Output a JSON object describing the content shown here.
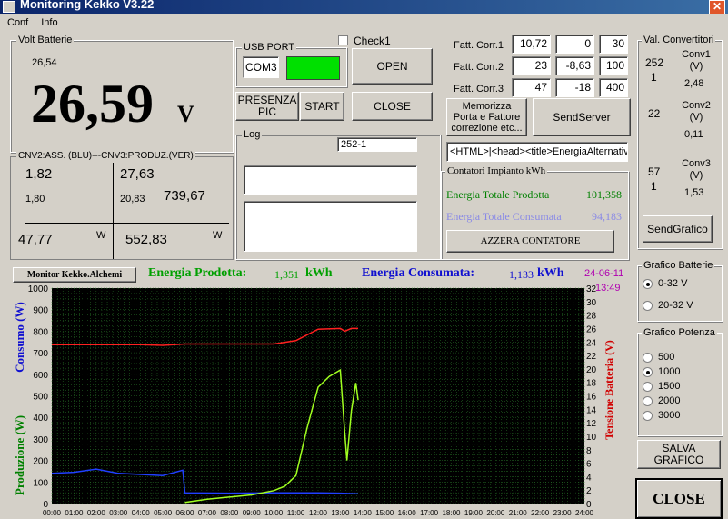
{
  "window": {
    "title": "Monitoring Kekko V3.22"
  },
  "menu": {
    "conf": "Conf",
    "info": "Info"
  },
  "volt": {
    "group": "Volt Batterie",
    "small": "26,54",
    "big": "26,59",
    "unit": "V"
  },
  "cnv": {
    "group": "CNV2:ASS. (BLU)---CNV3:PRODUZ.(VER)",
    "a1": "1,82",
    "a2": "1,80",
    "b1": "27,63",
    "b2": "20,83",
    "b3": "739,67",
    "w1": "47,77",
    "w1u": "W",
    "w2": "552,83",
    "w2u": "W"
  },
  "usb": {
    "group": "USB PORT",
    "port": "COM3",
    "status_color": "#00e000",
    "check1": "Check1",
    "open": "OPEN",
    "presenza": "PRESENZA PIC",
    "start": "START",
    "close": "CLOSE"
  },
  "log": {
    "group": "Log",
    "field1": "252-1",
    "field2": "",
    "field3": ""
  },
  "fatt": {
    "rows": [
      {
        "label": "Fatt. Corr.1",
        "v1": "10,72",
        "v2": "0",
        "v3": "30"
      },
      {
        "label": "Fatt. Corr.2",
        "v1": "23",
        "v2": "-8,63",
        "v3": "100"
      },
      {
        "label": "Fatt. Corr.3",
        "v1": "47",
        "v2": "-18",
        "v3": "400"
      }
    ],
    "memorizza": "Memorizza Porta e Fattore correzione etc...",
    "sendserver": "SendServer",
    "html": "<HTML>|<head><title>EnergiaAlternativa"
  },
  "contatori": {
    "group": "Contatori Impianto kWh",
    "prod_label": "Energia Totale Prodotta",
    "prod_value": "101,358",
    "cons_label": "Energia Totale Consumata",
    "cons_value": "94,183",
    "azzera": "AZZERA CONTATORE",
    "prod_color": "#008000",
    "cons_color": "#8a8ae6"
  },
  "conv": {
    "group": "Val. Convertitori",
    "c1": {
      "a": "252",
      "b": "1",
      "name": "Conv1 (V)",
      "val": "2,48"
    },
    "c2": {
      "a": "22",
      "b": "",
      "name": "Conv2 (V)",
      "val": "0,11"
    },
    "c3": {
      "a": "57",
      "b": "1",
      "name": "Conv3 (V)",
      "val": "1,53"
    },
    "sendgrafico": "SendGrafico"
  },
  "grafbat": {
    "group": "Grafico Batterie",
    "opts": [
      "0-32 V",
      "20-32 V"
    ],
    "selected": 0
  },
  "grafpot": {
    "group": "Grafico Potenza",
    "opts": [
      "500",
      "1000",
      "1500",
      "2000",
      "3000"
    ],
    "selected": 1
  },
  "salva": "SALVA GRAFICO",
  "closebig": "CLOSE",
  "monitor": {
    "brand": "Monitor Kekko.Alchemi",
    "prod_label": "Energia Prodotta:",
    "prod_val": "1,351",
    "prod_unit": "kWh",
    "cons_label": "Energia Consumata:",
    "cons_val": "1,133",
    "cons_unit": "kWh",
    "date": "24-06-11",
    "time": "13:49"
  },
  "chart_data": {
    "type": "line",
    "ylabel_left_top": "Consumo (W)",
    "ylabel_left_bottom": "Produzione (W)",
    "ylabel_right": "Tensione Batteria (V)",
    "y_left_ticks": [
      0,
      100,
      200,
      300,
      400,
      500,
      600,
      700,
      800,
      900,
      1000
    ],
    "y_right_ticks": [
      0,
      2,
      4,
      6,
      8,
      10,
      12,
      14,
      16,
      18,
      20,
      22,
      24,
      26,
      28,
      30,
      32
    ],
    "x_ticks": [
      "00:00",
      "01:00",
      "02:00",
      "03:00",
      "04:00",
      "05:00",
      "06:00",
      "07:00",
      "08:00",
      "09:00",
      "10:00",
      "11:00",
      "12:00",
      "13:00",
      "14:00",
      "15:00",
      "16:00",
      "17:00",
      "18:00",
      "19:00",
      "20:00",
      "21:00",
      "22:00",
      "23:00",
      "24:00"
    ],
    "xlim": [
      0,
      24
    ],
    "ylim_left": [
      0,
      1000
    ],
    "ylim_right": [
      0,
      32
    ],
    "grid": true,
    "series": [
      {
        "color": "#ff2020",
        "axis": "right",
        "x": [
          0,
          2,
          4,
          5,
          6,
          8,
          10,
          11,
          12,
          13,
          13.2,
          13.5,
          13.8
        ],
        "y": [
          23.6,
          23.6,
          23.6,
          23.5,
          23.7,
          23.7,
          23.7,
          24.2,
          25.9,
          26.0,
          25.6,
          26.0,
          26.0
        ]
      },
      {
        "color": "#2040ff",
        "axis": "left",
        "x": [
          0,
          1,
          2,
          3,
          4,
          5,
          5.9,
          6.0,
          8,
          10,
          12,
          13,
          13.8
        ],
        "y": [
          140,
          145,
          160,
          140,
          135,
          130,
          155,
          50,
          48,
          50,
          50,
          48,
          45
        ]
      },
      {
        "color": "#a0ff20",
        "axis": "left",
        "x": [
          6,
          7,
          8,
          9,
          10,
          10.5,
          11,
          11.5,
          12,
          12.5,
          13,
          13.2,
          13.3,
          13.5,
          13.7,
          13.8
        ],
        "y": [
          5,
          20,
          30,
          40,
          60,
          80,
          130,
          350,
          540,
          590,
          620,
          330,
          200,
          430,
          560,
          480
        ]
      }
    ]
  }
}
